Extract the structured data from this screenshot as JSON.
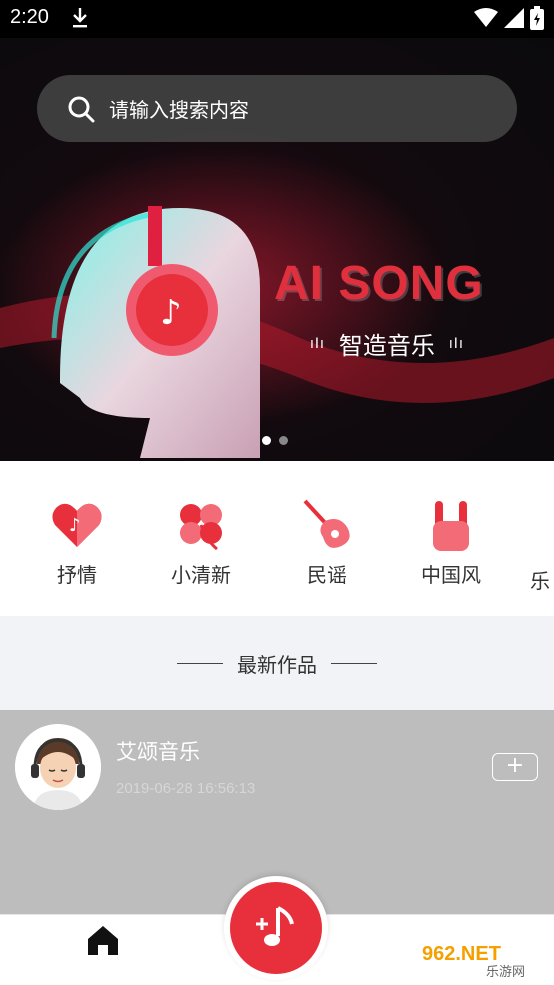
{
  "status": {
    "time": "2:20"
  },
  "search": {
    "placeholder": "请输入搜索内容"
  },
  "banner": {
    "title": "AI SONG",
    "subtitle": "智造音乐",
    "page_count": 2,
    "active_page": 1
  },
  "categories": [
    {
      "label": "抒情",
      "icon": "heart-note-icon"
    },
    {
      "label": "小清新",
      "icon": "clover-icon"
    },
    {
      "label": "民谣",
      "icon": "guitar-icon"
    },
    {
      "label": "中国风",
      "icon": "rock-hand-icon"
    },
    {
      "label": "乐",
      "icon": "partial-category-icon"
    }
  ],
  "section": {
    "title": "最新作品"
  },
  "work": {
    "author": "艾颂音乐",
    "time": "2019-06-28 16:56:13",
    "add_label": "+"
  },
  "colors": {
    "accent": "#e8303c",
    "banner_red": "#e0303e"
  },
  "watermark": {
    "text": "962.NET",
    "sub": "乐游网"
  }
}
